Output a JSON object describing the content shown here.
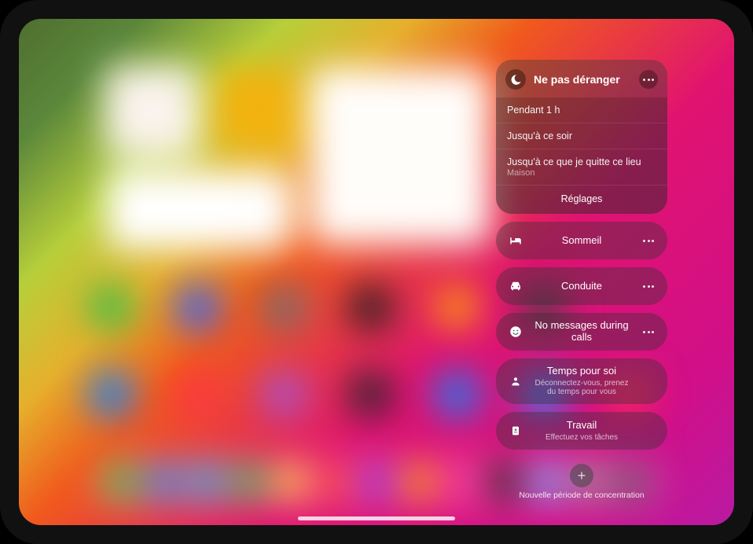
{
  "focus": {
    "dnd": {
      "title": "Ne pas déranger"
    },
    "options": [
      {
        "label": "Pendant 1 h",
        "sub": ""
      },
      {
        "label": "Jusqu'à ce soir",
        "sub": ""
      },
      {
        "label": "Jusqu'à ce que je quitte ce lieu",
        "sub": "Maison"
      }
    ],
    "settings_label": "Réglages",
    "modes": [
      {
        "title": "Sommeil",
        "sub": "",
        "icon": "bed",
        "more": true
      },
      {
        "title": "Conduite",
        "sub": "",
        "icon": "car",
        "more": true
      },
      {
        "title": "No messages during calls",
        "sub": "",
        "icon": "smile",
        "more": true
      },
      {
        "title": "Temps pour soi",
        "sub": "Déconnectez-vous, prenez du temps pour vous",
        "icon": "person",
        "more": false
      },
      {
        "title": "Travail",
        "sub": "Effectuez vos tâches",
        "icon": "badge",
        "more": false
      }
    ],
    "new_label": "Nouvelle période de concentration"
  },
  "icons": {
    "row1": [
      "#2dbf4a",
      "#2a62ff",
      "#6c6f76",
      "#1d1d1e",
      "#ff9f0a",
      "#3f3f3f"
    ],
    "row2": [
      "#0b84ff",
      "#ff3346",
      "#a056d6",
      "#22262a",
      "#0a84ff",
      "#1a8cff",
      "#ff2d55"
    ],
    "dock": [
      "#34c759",
      "#1f8cff",
      "#1cb0f6",
      "#34c759",
      "#ffd93a",
      "#ff453a",
      "#9d34da",
      "#ff9500",
      "#ff2d96",
      "#1f1f1f",
      "#66a6ff",
      "#8e8e93",
      "#5e5e63"
    ]
  }
}
